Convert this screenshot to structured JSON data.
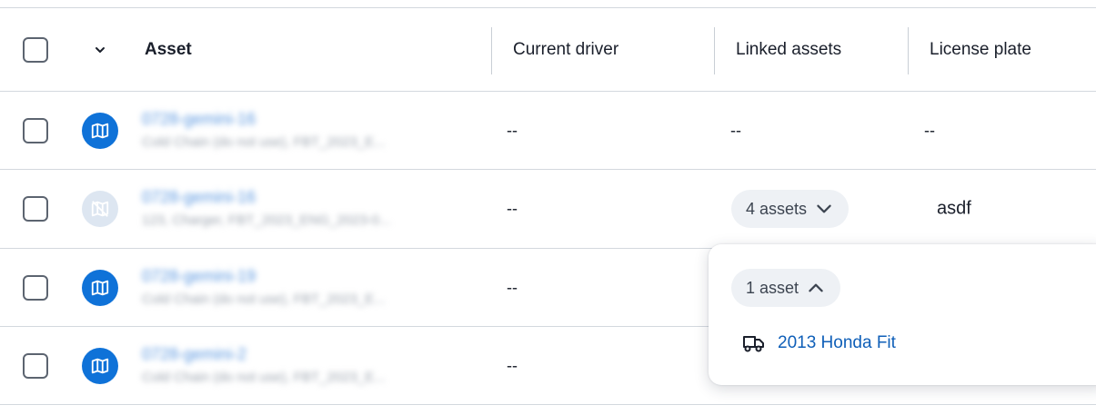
{
  "header": {
    "asset": "Asset",
    "current_driver": "Current driver",
    "linked_assets": "Linked assets",
    "license_plate": "License plate"
  },
  "rows": [
    {
      "name": "0728-gemini-16",
      "sub": "Cold Chain (do not use), FBT_2023_E...",
      "icon": "map-icon",
      "driver": "--",
      "linked": "--",
      "plate": "--"
    },
    {
      "name": "0728-gemini-16",
      "sub": "123, Charger, FBT_2023_ENG_2023-0...",
      "icon": "map-off-icon",
      "driver": "--",
      "linked": "4 assets",
      "plate": "asdf"
    },
    {
      "name": "0728-gemini-19",
      "sub": "Cold Chain (do not use), FBT_2023_E...",
      "icon": "map-icon",
      "driver": "--"
    },
    {
      "name": "0728-gemini-2",
      "sub": "Cold Chain (do not use), FBT_2023_E...",
      "icon": "map-icon",
      "driver": "--"
    }
  ],
  "popover": {
    "pill_label": "1 asset",
    "item_label": "2013 Honda Fit",
    "item_icon": "truck-icon"
  },
  "colors": {
    "accent": "#0f72d8",
    "link": "#0f5fb8",
    "pill_bg": "#eef1f5",
    "border": "#d3d8de"
  }
}
